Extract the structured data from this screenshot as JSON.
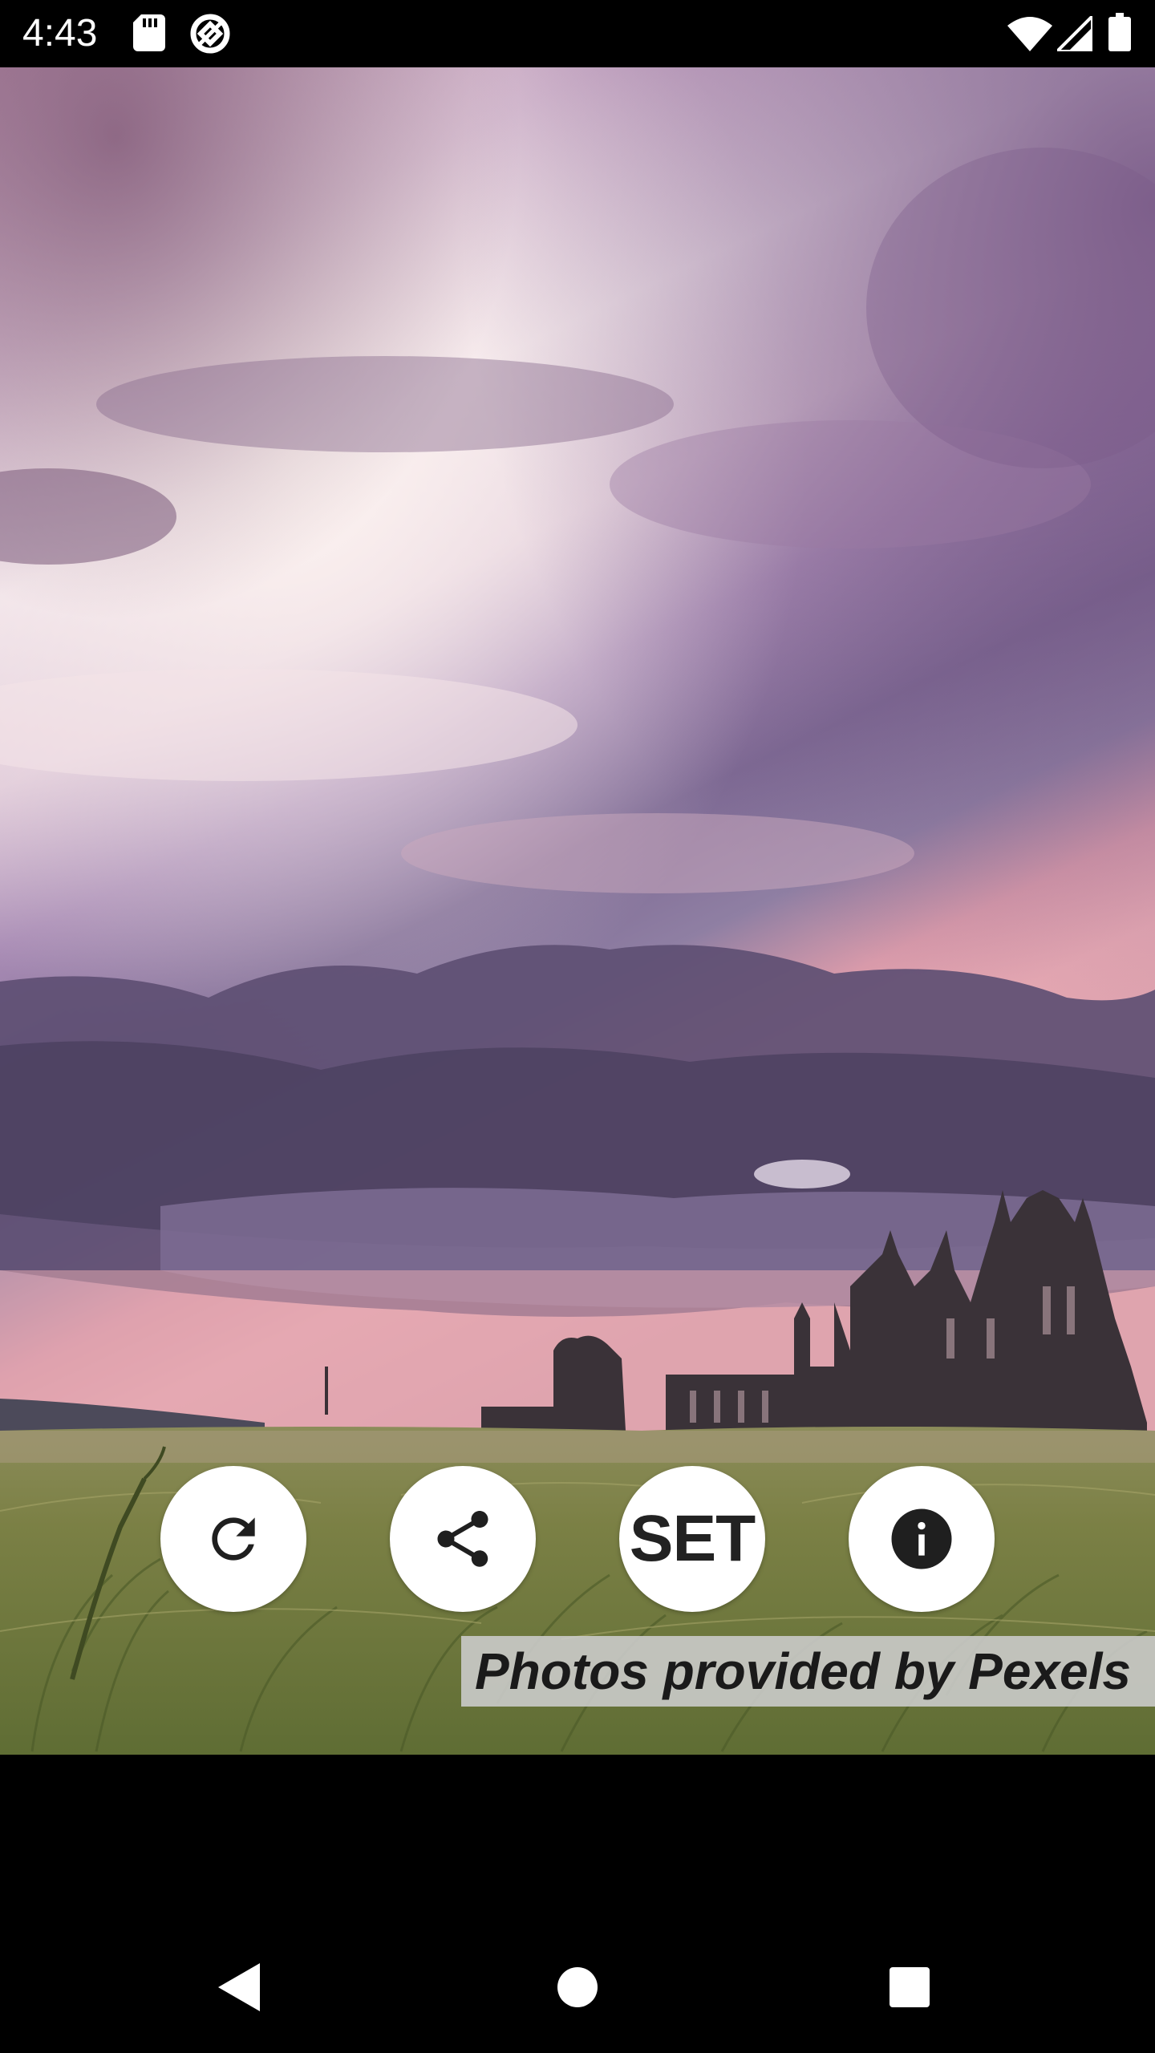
{
  "status_bar": {
    "time": "4:43",
    "icons": [
      "sd-card-icon",
      "data-saver-icon",
      "wifi-icon",
      "cellular-signal-icon",
      "battery-icon"
    ]
  },
  "wallpaper": {
    "description_icon": "wallpaper-photo"
  },
  "actions": {
    "refresh_icon": "refresh-icon",
    "share_icon": "share-icon",
    "set_label": "SET",
    "info_icon": "info-icon"
  },
  "credit": {
    "text": "Photos provided by Pexels"
  },
  "nav_bar": {
    "icons": [
      "back-icon",
      "home-icon",
      "recents-icon"
    ]
  },
  "colors": {
    "button_bg": "#ffffff",
    "icon_color": "#1f1f1f",
    "credit_bg": "#cdcdcd",
    "system_bar": "#000000"
  }
}
